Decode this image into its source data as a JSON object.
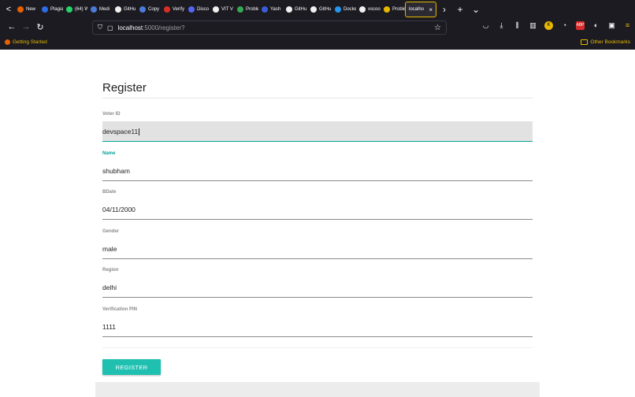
{
  "browser": {
    "tabs": [
      {
        "label": "New",
        "color": "#e66000"
      },
      {
        "label": "Plagia",
        "color": "#2c6ce4"
      },
      {
        "label": "(64) W",
        "color": "#25d366"
      },
      {
        "label": "Medi",
        "color": "#4a7bd8"
      },
      {
        "label": "GitHu",
        "color": "#f0f0f0"
      },
      {
        "label": "Copy",
        "color": "#4a7bd8"
      },
      {
        "label": "Verify",
        "color": "#d93025"
      },
      {
        "label": "Disco",
        "color": "#5865f2"
      },
      {
        "label": "VIT V",
        "color": "#f0f0f0"
      },
      {
        "label": "Proble",
        "color": "#34a853"
      },
      {
        "label": "Yash",
        "color": "#3b5bdb"
      },
      {
        "label": "GitHu",
        "color": "#f0f0f0"
      },
      {
        "label": "GitHu",
        "color": "#f0f0f0"
      },
      {
        "label": "Docke",
        "color": "#2496ed"
      },
      {
        "label": "vscoo",
        "color": "#f0f0f0"
      },
      {
        "label": "Proble",
        "color": "#e6b800"
      }
    ],
    "active_tab": {
      "label": "localho",
      "close": "×"
    },
    "scroll_left": "<",
    "scroll_right": "›",
    "new_tab": "+",
    "tab_list": "⌄",
    "url_host": "localhost",
    "url_path": ":5000/register?",
    "bookmark": "Getting Started",
    "other_bookmarks": "Other Bookmarks",
    "accent": "#e6b800"
  },
  "form": {
    "title": "Register",
    "fields": [
      {
        "label": "Voter ID",
        "value": "devspace11"
      },
      {
        "label": "Name",
        "value": "shubham"
      },
      {
        "label": "BDate",
        "value": "04/11/2000"
      },
      {
        "label": "Gender",
        "value": "male"
      },
      {
        "label": "Region",
        "value": "delhi"
      },
      {
        "label": "Verification PIN",
        "value": "1111"
      }
    ],
    "submit_label": "REGISTER",
    "accent": "#1fc0b0"
  }
}
